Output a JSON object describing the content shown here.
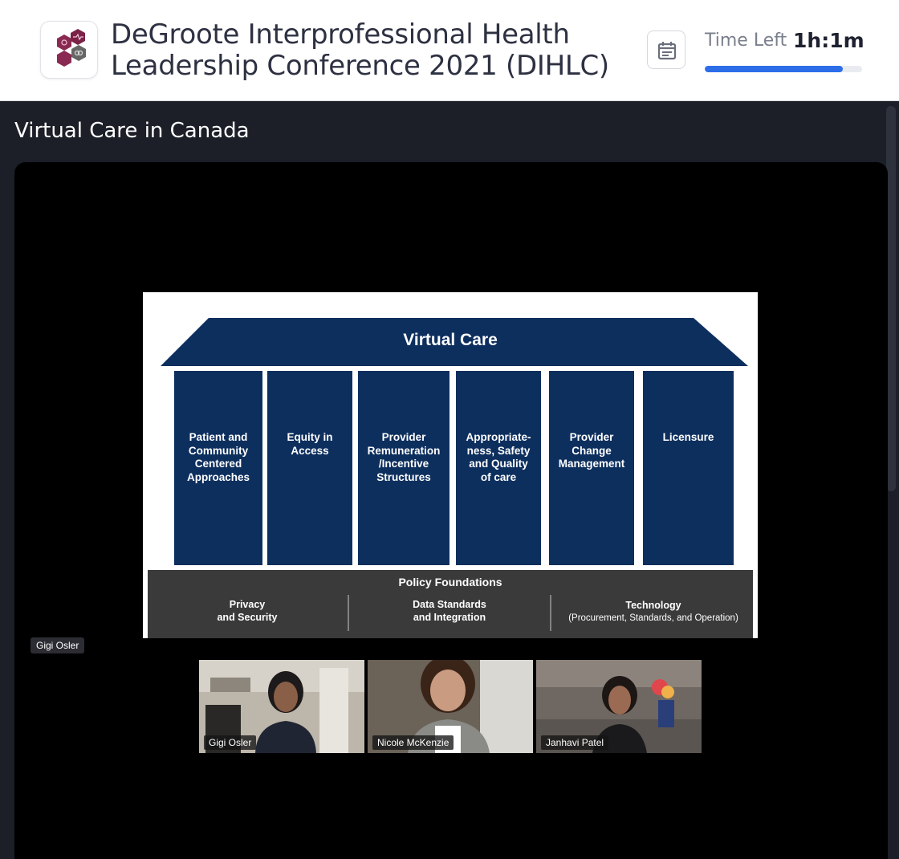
{
  "header": {
    "logo_icon": "hexagon-logo-icon",
    "event_title": "DeGroote Interprofessional Health Leadership Conference 2021 (DIHLC)",
    "calendar_icon": "calendar-icon",
    "time_left_label": "Time Left",
    "time_left_value": "1h:1m",
    "time_progress_fraction": 0.88,
    "accent_color": "#2d6ee8"
  },
  "session": {
    "title": "Virtual Care in Canada"
  },
  "slide": {
    "roof": "Virtual Care",
    "pillars": [
      {
        "label": "Patient and\nCommunity\nCentered\nApproaches"
      },
      {
        "label": "Equity in\nAccess"
      },
      {
        "label": "Provider\nRemuneration\n/Incentive\nStructures"
      },
      {
        "label": "Appropriate-\nness, Safety\nand Quality\nof care"
      },
      {
        "label": "Provider\nChange\nManagement"
      },
      {
        "label": "Licensure"
      }
    ],
    "policy_title": "Policy Foundations",
    "foundations": [
      {
        "title": "Privacy\nand Security",
        "subtitle": ""
      },
      {
        "title": "Data Standards\nand Integration",
        "subtitle": ""
      },
      {
        "title": "Technology",
        "subtitle": "(Procurement, Standards, and Operation)"
      }
    ],
    "pillar_color": "#0d2f5e",
    "foundation_color": "#3a3a3a"
  },
  "active_speaker": "Gigi Osler",
  "participants": [
    {
      "name": "Gigi Osler"
    },
    {
      "name": "Nicole McKenzie"
    },
    {
      "name": "Janhavi Patel"
    }
  ]
}
